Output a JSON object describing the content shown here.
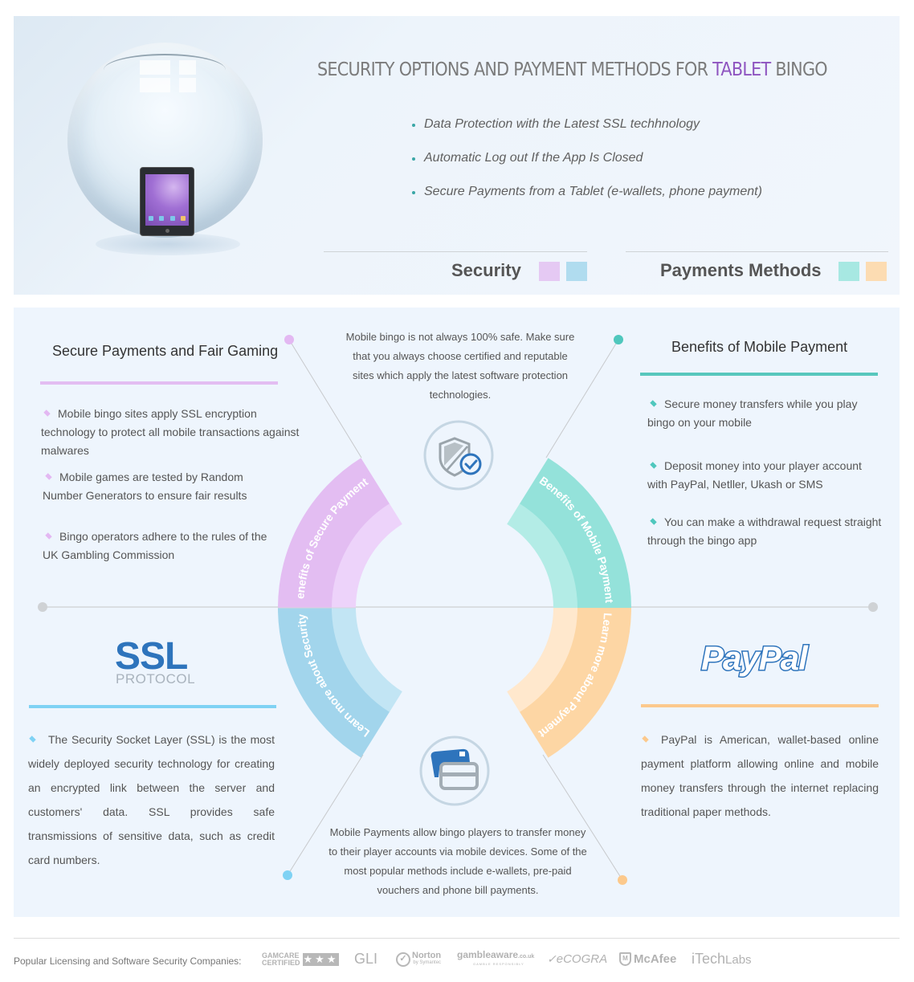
{
  "hero": {
    "title_prefix": "SECURITY OPTIONS AND PAYMENT METHODS FOR ",
    "title_accent": "TABLET",
    "title_suffix": " BINGO",
    "bullets": [
      "Data Protection with the Latest SSL techhnology",
      "Automatic Log out If the App Is Closed",
      "Secure Payments from a Tablet (e-wallets, phone payment)"
    ],
    "illustration": "crystal-orb-with-tablet"
  },
  "legend": [
    {
      "label": "Security",
      "colors": [
        "#e5c9f3",
        "#b0dcef"
      ]
    },
    {
      "label": "Payments Methods",
      "colors": [
        "#a7e8e2",
        "#fcdcb2"
      ]
    }
  ],
  "colors": {
    "purple": "#e3bdf2",
    "purple_light": "#edd3fa",
    "blue": "#a2d5ec",
    "blue_light": "#c2e5f4",
    "teal": "#94e2da",
    "teal_light": "#b3ece6",
    "orange": "#fdd6a4",
    "orange_light": "#ffe8cd",
    "ssl_blue": "#2e74bc",
    "bullet_purple": "#e3b8f2",
    "bullet_teal": "#4fc7bd",
    "bullet_blue": "#7fd2f4",
    "bullet_orange": "#fcc98c"
  },
  "secure_section": {
    "title": "Secure Payments and Fair Gaming",
    "bullets": [
      "Mobile bingo sites apply SSL encryption technology to protect all mobile transactions against malwares",
      "Mobile games are tested by Random Number Generators to ensure fair results",
      "Bingo operators adhere to the rules of the UK Gambling Commission"
    ]
  },
  "mobile_section": {
    "title": "Benefits of Mobile Payment",
    "bullets": [
      "Secure money transfers while you play bingo on your mobile",
      "Deposit money into your player account with PayPal, Netller, Ukash or SMS",
      "You can make a withdrawal request straight through the bingo app"
    ]
  },
  "ssl_section": {
    "logo": "SSL",
    "logo_sub": "PROTOCOL",
    "text": "The Security Socket Layer (SSL) is the most widely deployed security technology for creating an encrypted link between the server and customers' data. SSL provides safe transmissions of sensitive data, such as credit card numbers."
  },
  "paypal_section": {
    "logo": "PayPal",
    "text": "PayPal is American, wallet-based online payment platform allowing online and mobile money transfers through the internet replacing traditional paper methods."
  },
  "center": {
    "top_text": "Mobile bingo is not always 100% safe. Make sure that you always choose certified and reputable sites which apply the latest software protection technologies.",
    "bottom_text": "Mobile Payments allow bingo players to transfer money to their player accounts via mobile devices. Some of the most popular methods include e-wallets, pre-paid vouchers and phone bill payments.",
    "arcs": [
      {
        "label": "Benefits of Secure Payments",
        "quadrant": "top-left"
      },
      {
        "label": "Benefits of Mobile Payment",
        "quadrant": "top-right"
      },
      {
        "label": "Learn more about Security",
        "quadrant": "bottom-left"
      },
      {
        "label": "Learn more about Payment",
        "quadrant": "bottom-right"
      }
    ]
  },
  "footer": {
    "label": "Popular Licensing and  Software Security Companies:",
    "logos": [
      {
        "name": "gamcare",
        "text_top": "GAMCARE",
        "text_bottom": "CERTIFIED",
        "stars": "★★★"
      },
      {
        "name": "gli",
        "text": "GLI"
      },
      {
        "name": "norton",
        "text": "Norton",
        "sub": "by Symantec"
      },
      {
        "name": "gambleaware",
        "text": "gambleaware",
        "suffix": ".co.uk",
        "sub": "GAMBLE RESPONSIBLY"
      },
      {
        "name": "ecogra",
        "text": "eCOGRA"
      },
      {
        "name": "mcafee",
        "text": "McAfee"
      },
      {
        "name": "itechlabs",
        "text_bold": "iTech",
        "text_light": "Labs"
      }
    ]
  }
}
